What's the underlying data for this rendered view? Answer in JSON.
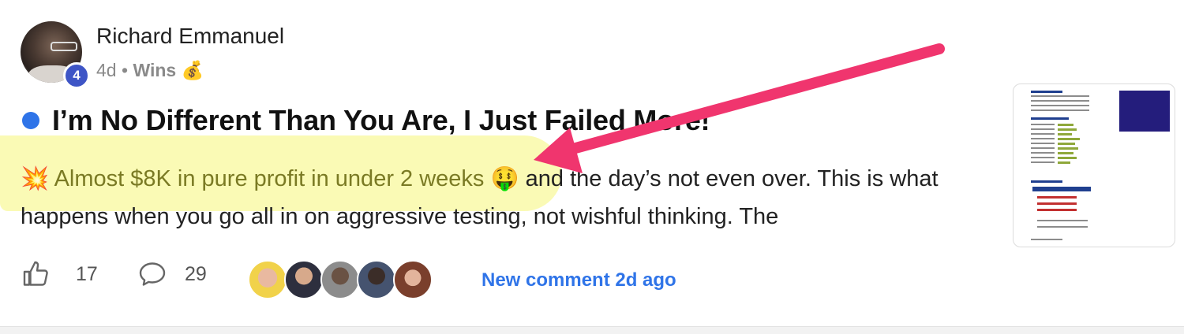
{
  "post": {
    "author": "Richard Emmanuel",
    "level": "4",
    "age": "4d",
    "separator": "•",
    "category": "Wins",
    "category_emoji": "💰",
    "title": "I’m No Different Than You Are, I Just Failed More!",
    "body_emoji": "💥",
    "body_highlight": "Almost $8K in pure profit in under 2 weeks",
    "body_emoji2": "🤑",
    "body_rest": "and the day’s not even over. This is what happens when you go all in on aggressive testing, not wishful thinking. The"
  },
  "footer": {
    "likes": "17",
    "comments": "29",
    "new_comment": "New comment 2d ago"
  },
  "colors": {
    "accent": "#2f74e8",
    "arrow": "#f0356e",
    "highlight": "#f6f678",
    "level_badge": "#3e55c6"
  },
  "icons": {
    "like": "thumbs-up-icon",
    "comment": "speech-bubble-icon"
  }
}
